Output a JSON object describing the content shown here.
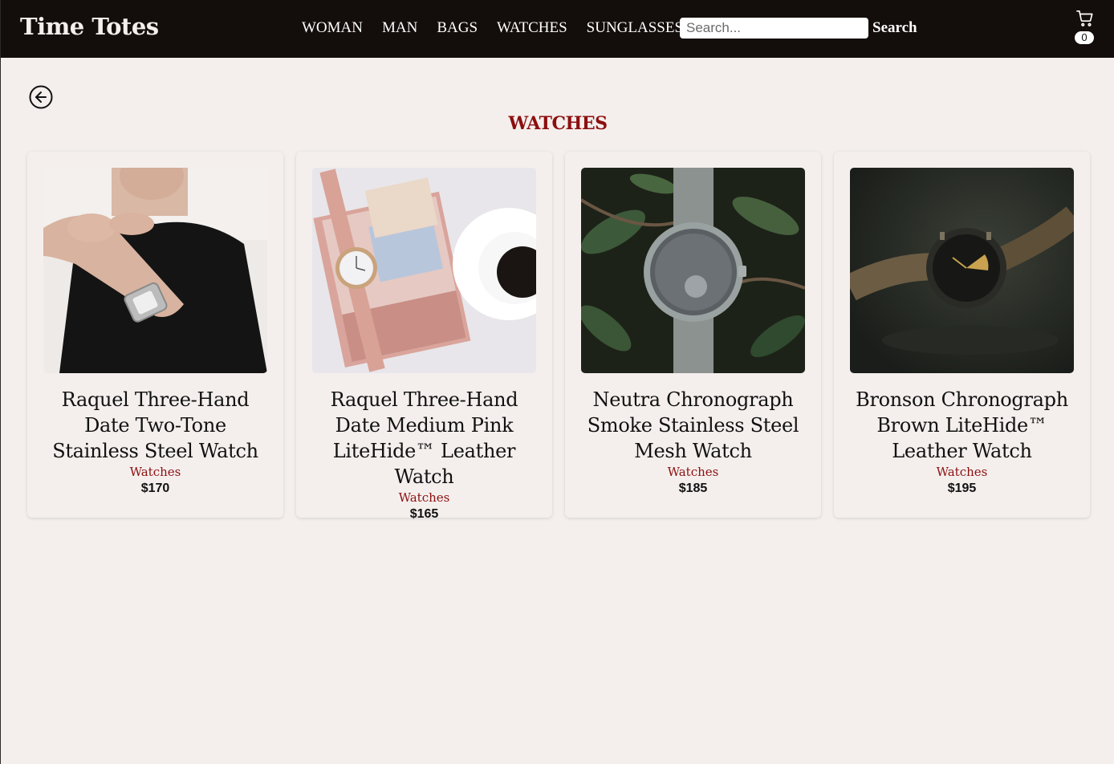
{
  "header": {
    "brand": "Time Totes",
    "nav": [
      "WOMAN",
      "MAN",
      "BAGS",
      "WATCHES",
      "SUNGLASSES"
    ],
    "search_placeholder": "Search...",
    "search_value": "",
    "search_button": "Search",
    "cart_icon": "shopping-cart-icon",
    "cart_count": "0"
  },
  "back_icon": "arrow-left-circle-icon",
  "category_title": "WATCHES",
  "products": [
    {
      "name": "Raquel Three-Hand Date Two-Tone Stainless Steel Watch",
      "category": "Watches",
      "price": "$170"
    },
    {
      "name": "Raquel Three-Hand Date Medium Pink LiteHide™ Leather Watch",
      "category": "Watches",
      "price": "$165"
    },
    {
      "name": "Neutra Chronograph Smoke Stainless Steel Mesh Watch",
      "category": "Watches",
      "price": "$185"
    },
    {
      "name": "Bronson Chronograph Brown LiteHide™ Leather Watch",
      "category": "Watches",
      "price": "$195"
    }
  ],
  "colors": {
    "navbar": "#130e0b",
    "background": "#f4efed",
    "accent": "#8c0f0f"
  }
}
